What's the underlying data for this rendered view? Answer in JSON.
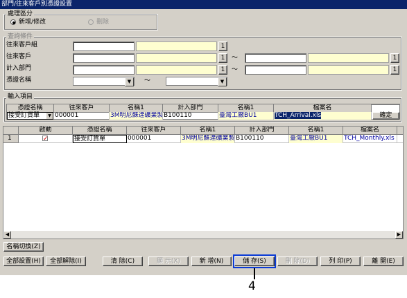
{
  "window": {
    "title": "部門/往來客戶別憑證設置"
  },
  "mode_group": {
    "label": "處理區分",
    "options": [
      {
        "label": "新增/修改",
        "selected": true
      },
      {
        "label": "刪除",
        "selected": false
      }
    ]
  },
  "criteria_group": {
    "label": "查詢條件",
    "rows": [
      {
        "label": "往來客戶組"
      },
      {
        "label": "往來客戶"
      },
      {
        "label": "計入部門"
      },
      {
        "label": "憑證名稱"
      }
    ],
    "lookup_button": "1",
    "range_sep": "～"
  },
  "input_group": {
    "label": "輸入項目",
    "headers": [
      "憑證名稱",
      "往來客戶",
      "名稱1",
      "計入部門",
      "名稱1",
      "檔案名"
    ],
    "values": {
      "voucher": "接受訂貨單",
      "customer_code": "000001",
      "customer_name": "3M明尼蘇達礦業製造",
      "dept_code": "B100110",
      "dept_name": "臺灣工廠BU1",
      "file_name": "TCH_Arrival.xls"
    },
    "confirm_button": "確定"
  },
  "grid": {
    "headers": [
      "",
      "啟動",
      "憑證名稱",
      "往來客戶",
      "名稱1",
      "計入部門",
      "名稱1",
      "檔案名"
    ],
    "rows": [
      {
        "no": "1",
        "active": true,
        "voucher": "接受訂貨單",
        "customer_code": "000001",
        "customer_name": "3M明尼蘇達礦業製造",
        "dept_code": "B100110",
        "dept_name": "臺灣工廠BU1",
        "file_name": "TCH_Monthly.xls"
      }
    ]
  },
  "buttons": {
    "name_toggle": "名稱切換(Z)",
    "select_all": "全部設置(H)",
    "deselect_all": "全部解除(I)",
    "clear": "清 除(C)",
    "display": "顯 示(X)",
    "add": "新 增(N)",
    "save": "儲 存(S)",
    "delete": "刪 除(D)",
    "print": "列 印(P)",
    "exit": "離 開(E)"
  },
  "callout": {
    "number": "4",
    "color": "#0b3bd6"
  }
}
